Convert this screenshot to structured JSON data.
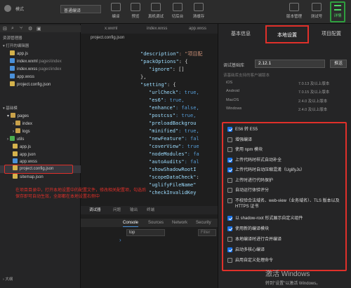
{
  "toolbar": {
    "mode_label": "模式",
    "compile_mode": "普通编译",
    "buttons": [
      "编译",
      "预览",
      "真机调试",
      "切后台",
      "清缓存"
    ],
    "right_buttons": [
      "版本管理",
      "测试号"
    ],
    "review": "详情"
  },
  "explorer": {
    "title": "资源管理器",
    "open_editors": "打开的编辑器",
    "open_files": [
      {
        "name": "app.js",
        "dir": ""
      },
      {
        "name": "index.wxml",
        "dir": "pages\\index"
      },
      {
        "name": "index.wxss",
        "dir": "pages\\index"
      },
      {
        "name": "app.wxss",
        "dir": ""
      },
      {
        "name": "project.config.json",
        "dir": ""
      }
    ],
    "project_section": "基础模",
    "tree": [
      "pages",
      "index",
      "logs",
      "utils",
      "app.js",
      "app.json",
      "app.wxss",
      "project.config.json",
      "sitemap.json"
    ],
    "outline": "大纲"
  },
  "editor": {
    "tabs": [
      "x.wxml",
      "index.wxss",
      "app.wxss"
    ],
    "breadcrumb": "project.config.json",
    "lines": [
      {
        "key": "\"description\"",
        "val": ": \"项目配"
      },
      {
        "key": "\"packOptions\"",
        "val": ": {"
      },
      {
        "key": "\"ignore\"",
        "val": ": []"
      },
      {
        "key": "},",
        "val": ""
      },
      {
        "key": "\"setting\"",
        "val": ": {"
      },
      {
        "key": "\"urlCheck\"",
        "val": ": true,"
      },
      {
        "key": "\"es6\"",
        "val": ": true,"
      },
      {
        "key": "\"enhance\"",
        "val": ": false,"
      },
      {
        "key": "\"postcss\"",
        "val": ": true,"
      },
      {
        "key": "\"preloadBackgrou",
        "val": ""
      },
      {
        "key": "\"minified\"",
        "val": ": true,"
      },
      {
        "key": "\"newFeature\"",
        "val": ": fal"
      },
      {
        "key": "\"coverView\"",
        "val": ": true"
      },
      {
        "key": "\"nodeModules\"",
        "val": ": fa"
      },
      {
        "key": "\"autoAudits\"",
        "val": ": fal"
      },
      {
        "key": "\"showShadowRootI",
        "val": ""
      },
      {
        "key": "\"scopeDataCheck\"",
        "val": ":"
      },
      {
        "key": "\"uglifyFileName\"",
        "val": ""
      },
      {
        "key": "\"checkInvalidKey",
        "val": ""
      }
    ]
  },
  "annotation": "在项目目录中，打开本地设置中的配置文件，修改相关配置项，勾选后保存即可自动生效，全部都在本地设置右侧中",
  "devtools": {
    "tabs": [
      "调试器",
      "问题",
      "输出",
      "终端"
    ],
    "console_tabs": [
      "Console",
      "Sources",
      "Network",
      "Security"
    ],
    "context": "top",
    "filter": "Filter"
  },
  "panel": {
    "tabs": [
      "基本信息",
      "本地设置",
      "项目配置"
    ],
    "lib_label": "调试基础库",
    "lib_version": "2.12.1",
    "push": "推送",
    "hint": "该基础库支持的客户端版本",
    "platforms": [
      {
        "os": "iOS",
        "ver": "7.0.13 及以上版本"
      },
      {
        "os": "Android",
        "ver": "7.0.15 及以上版本"
      },
      {
        "os": "MacOS",
        "ver": "2.4.0 及以上版本"
      },
      {
        "os": "Windows",
        "ver": "2.4.0 及以上版本"
      }
    ],
    "options": [
      {
        "label": "ES6 转 ES5",
        "checked": true
      },
      {
        "label": "增强编译",
        "checked": false
      },
      {
        "label": "使用 npm 模块",
        "checked": false
      },
      {
        "label": "上传代码时样式自动补全",
        "checked": true
      },
      {
        "label": "上传代码时自动压缩混淆（UglifyJs）",
        "checked": true
      },
      {
        "label": "上传时进行代码保护",
        "checked": false
      },
      {
        "label": "自动运行体验评分",
        "checked": false
      },
      {
        "label": "不校验合法域名、web-view（业务域名）、TLS 版本以及 HTTPS 证书",
        "checked": false
      },
      {
        "label": "以 shadow-root 形式展示自定义组件",
        "checked": true
      },
      {
        "label": "使用新的编译模块",
        "checked": true
      },
      {
        "label": "本地编译时进行合并编译",
        "checked": false
      },
      {
        "label": "启动多核心编译",
        "checked": true
      },
      {
        "label": "启用自定义处理命令",
        "checked": false
      }
    ]
  },
  "watermark": {
    "line1": "激活 Windows",
    "line2": "转到\"设置\"以激活 Windows。"
  }
}
